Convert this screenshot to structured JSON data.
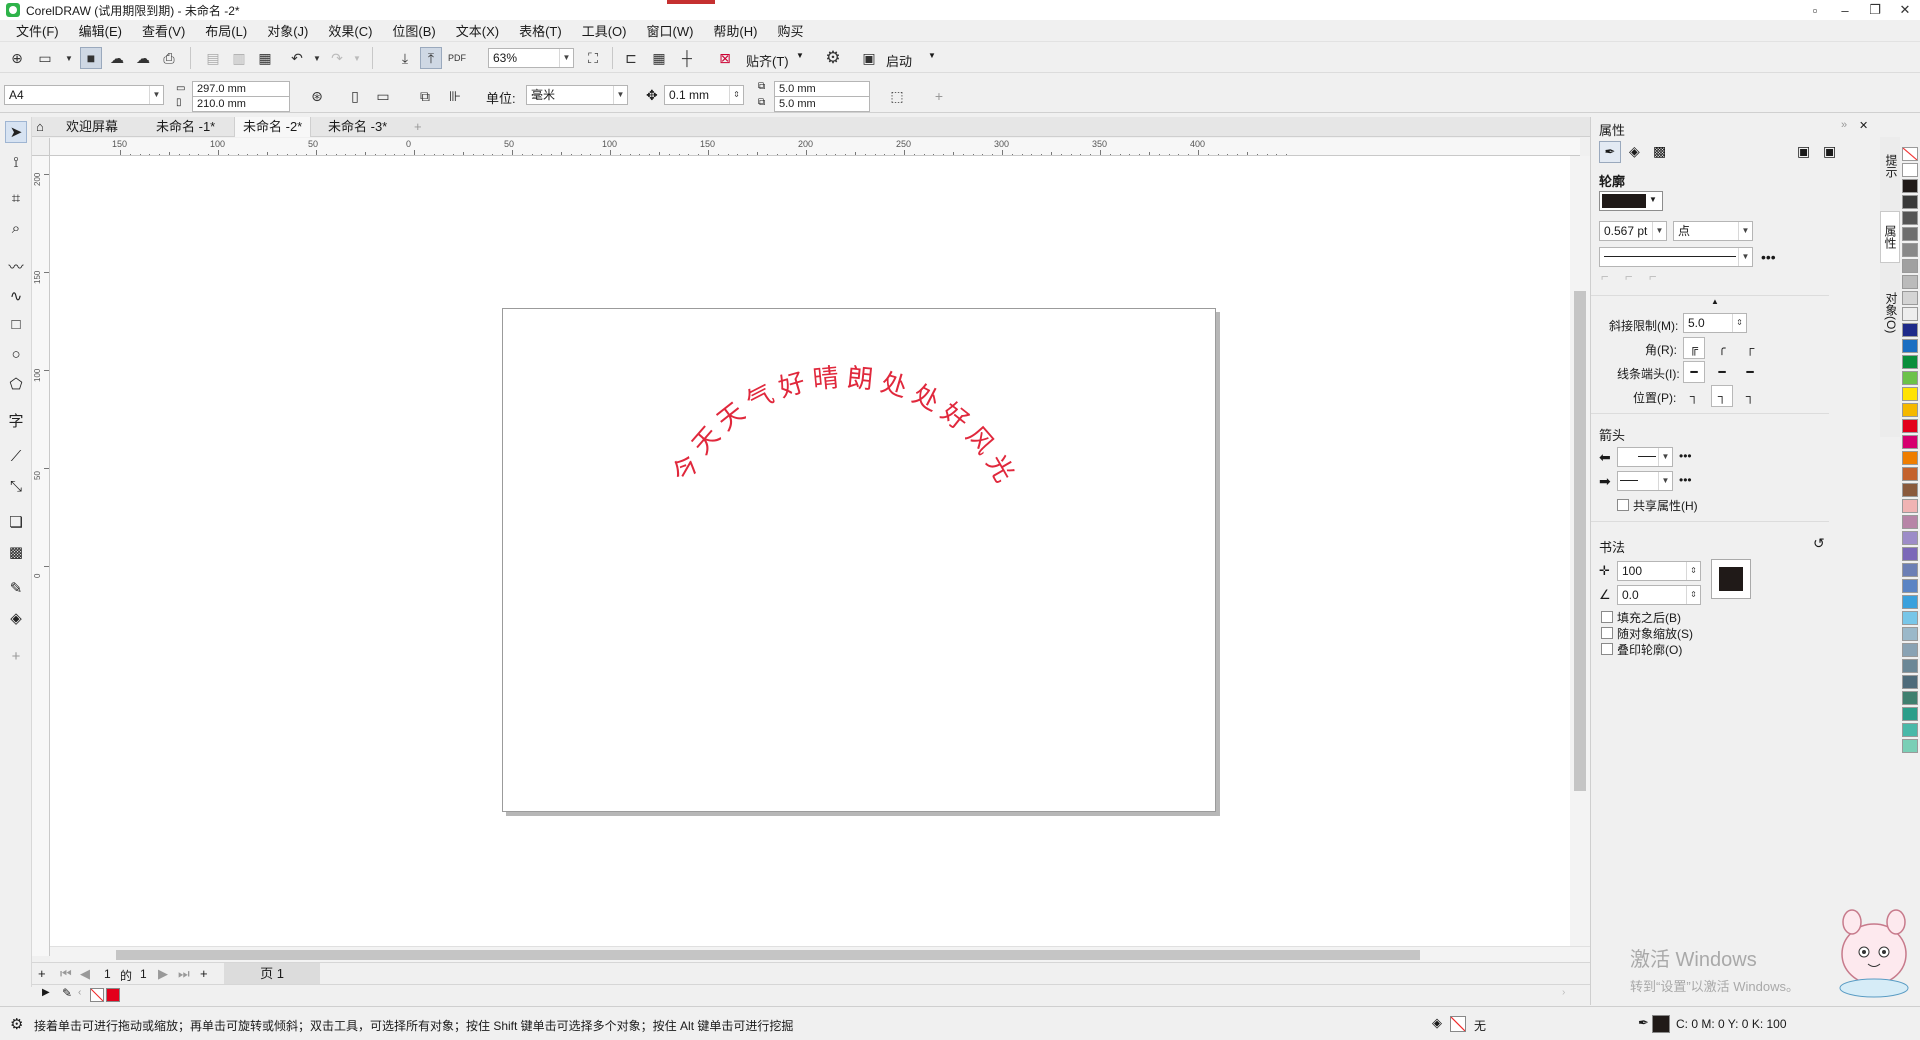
{
  "titlebar": {
    "title": "CorelDRAW (试用期限到期) - 未命名 -2*",
    "buttons": [
      "▫",
      "–",
      "❐",
      "✕"
    ]
  },
  "menu": [
    "文件(F)",
    "编辑(E)",
    "查看(V)",
    "布局(L)",
    "对象(J)",
    "效果(C)",
    "位图(B)",
    "文本(X)",
    "表格(T)",
    "工具(O)",
    "窗口(W)",
    "帮助(H)",
    "购买"
  ],
  "toolbar1": {
    "zoom": "63%",
    "snap_label": "贴齐(T)",
    "launch_label": "启动"
  },
  "toolbar2": {
    "page_size": "A4",
    "width": "297.0 mm",
    "height": "210.0 mm",
    "units_label": "单位:",
    "units_value": "毫米",
    "nudge": "0.1 mm",
    "dup_x": "5.0 mm",
    "dup_y": "5.0 mm"
  },
  "doc_tabs": [
    "欢迎屏幕",
    "未命名 -1*",
    "未命名 -2*",
    "未命名 -3*"
  ],
  "active_tab": 2,
  "ruler": {
    "h_labels": [
      "150",
      "100",
      "50",
      "0",
      "50",
      "100",
      "150",
      "200",
      "250",
      "300",
      "350",
      "400"
    ],
    "v_labels": [
      "200",
      "150",
      "100",
      "50",
      "0"
    ]
  },
  "canvas": {
    "arc_text": "今天天气好晴朗处处好风光",
    "text_color": "#e0283c"
  },
  "page_nav": {
    "current": "1",
    "of_label": "的",
    "total": "1",
    "page_tab": "页 1"
  },
  "status": {
    "hint": "接着单击可进行拖动或缩放；再单击可旋转或倾斜；双击工具，可选择所有对象；按住 Shift 键单击可选择多个对象；按住 Alt 键单击可进行挖掘",
    "fill_none": "无",
    "cmyk": "C: 0 M: 0 Y: 0 K: 100"
  },
  "docker": {
    "title": "属性",
    "outline_title": "轮廓",
    "outline_color": "#201a18",
    "width_value": "0.567 pt",
    "width_unit": "点",
    "miter_label": "斜接限制(M):",
    "miter_value": "5.0",
    "corner_label": "角(R):",
    "cap_label": "线条端头(I):",
    "position_label": "位置(P):",
    "arrows_title": "箭头",
    "share_attr": "共享属性(H)",
    "calligraphy_title": "书法",
    "stretch_value": "100",
    "angle_value": "0.0",
    "fill_behind": "填充之后(B)",
    "scale_with": "随对象缩放(S)",
    "overprint": "叠印轮廓(O)"
  },
  "side_tabs": [
    "提示",
    "属性",
    "对象(O)"
  ],
  "palette": [
    "#ffffff",
    "#201a18",
    "#3a3a3a",
    "#545454",
    "#6e6e6e",
    "#878787",
    "#a1a1a1",
    "#bbbbbb",
    "#d4d4d4",
    "#eeeeee",
    "#1f2b8a",
    "#1b6fc2",
    "#0a8f3c",
    "#6cc24a",
    "#ffe300",
    "#f5b800",
    "#e3001b",
    "#d6006f",
    "#ef7d00",
    "#c4622d",
    "#8a5a3c",
    "#f0b3b3",
    "#b784a7",
    "#9d8cc8",
    "#7b68b8",
    "#6c7fb5",
    "#5a84c4",
    "#3aa0dc",
    "#78c6e8",
    "#9bb8c9",
    "#8aa3b4",
    "#6b8796",
    "#4e6b7a",
    "#3f7f6f",
    "#2b9e8a",
    "#49b8a8",
    "#7acfb6"
  ],
  "watermark": {
    "line1": "激活 Windows",
    "line2": "转到“设置”以激活 Windows。"
  }
}
